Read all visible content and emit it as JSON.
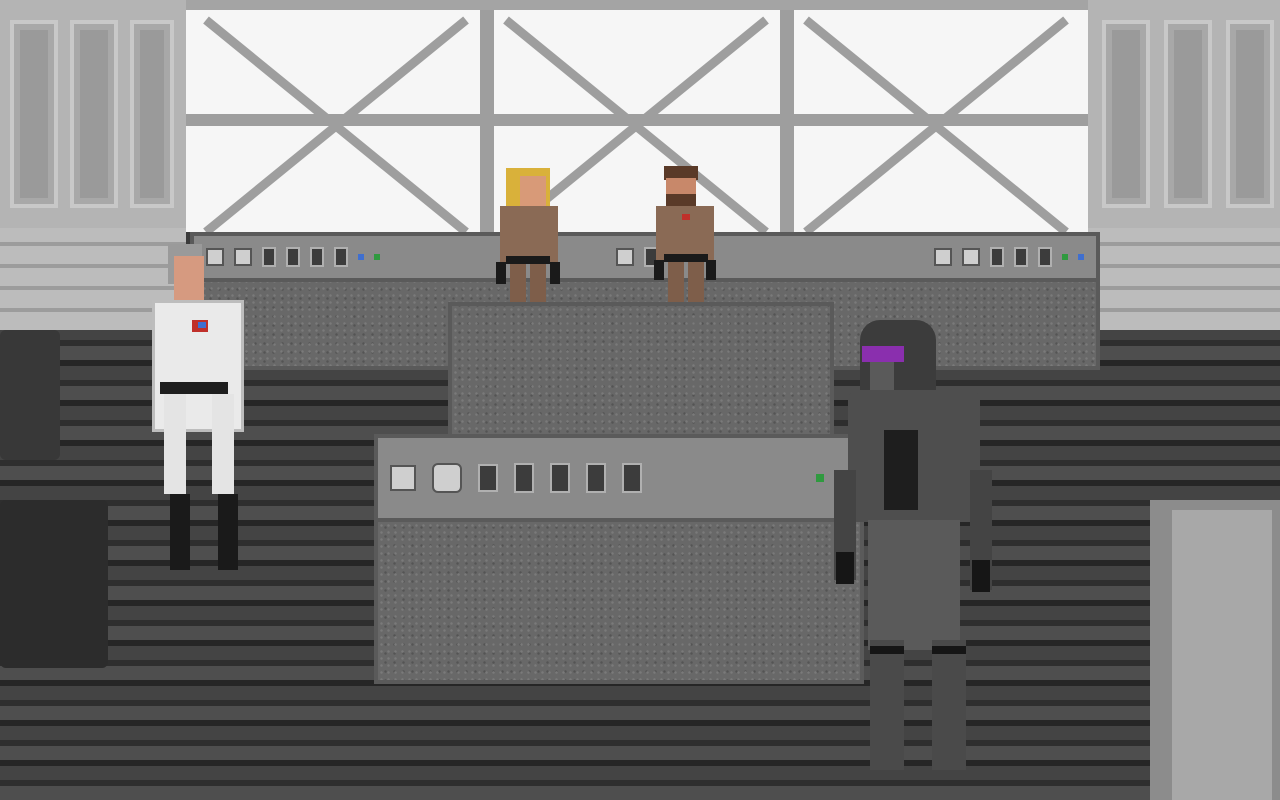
{
  "scene": {
    "name": "imperial-bridge",
    "palette": {
      "window": "#f6f6f6",
      "wall": "#b4b4b4",
      "floor": "#3a3a3a",
      "console": "#686868",
      "officer_uniform": "#eaeaea",
      "crew_uniform": "#8a6a55",
      "hair_blonde": "#d9b13a",
      "visor": "#8a2fae",
      "led_blue": "#3f6fd0",
      "led_green": "#2f9a3f",
      "insignia_red": "#c0302a"
    }
  },
  "characters": [
    {
      "id": "officer-white",
      "uniform": "white"
    },
    {
      "id": "crew-blonde",
      "uniform": "brown"
    },
    {
      "id": "crew-bearded",
      "uniform": "brown"
    },
    {
      "id": "droid-visor",
      "uniform": "dark-grey"
    }
  ]
}
